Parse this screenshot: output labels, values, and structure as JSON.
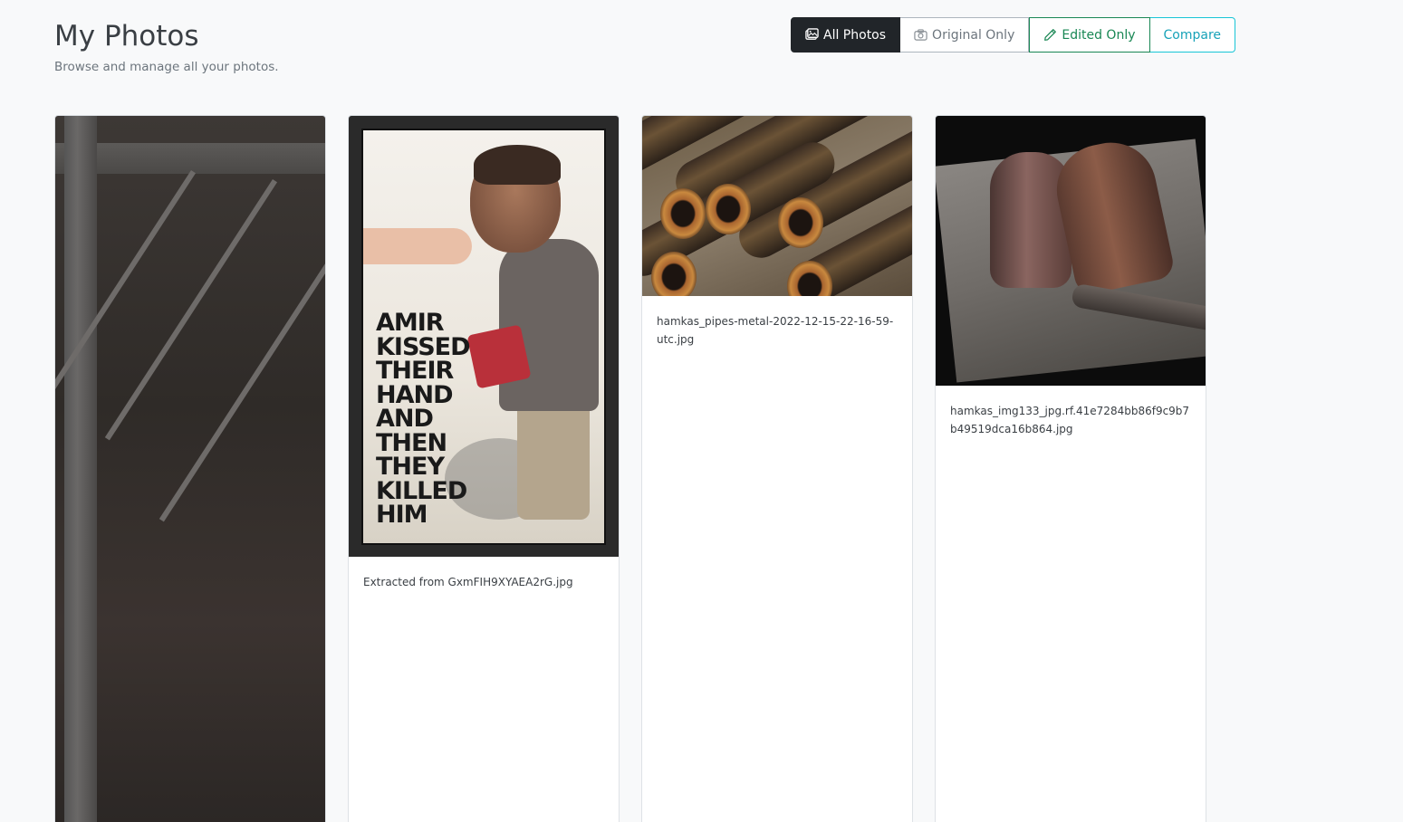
{
  "header": {
    "title": "My Photos",
    "subtitle": "Browse and manage all your photos."
  },
  "filters": {
    "all": {
      "label": "All Photos",
      "icon": "images-icon",
      "active": true
    },
    "original": {
      "label": "Original Only",
      "icon": "camera-icon"
    },
    "edited": {
      "label": "Edited Only",
      "icon": "pencil-icon"
    },
    "compare": {
      "label": "Compare"
    }
  },
  "photos": [
    {
      "caption": "",
      "alt": "metal fence close-up"
    },
    {
      "caption": "Extracted from GxmFIH9XYAEA2rG.jpg",
      "poster_text": [
        "AMIR",
        "KISSED",
        "THEIR",
        "HAND",
        "AND",
        "THEN",
        "THEY",
        "KILLED",
        "HIM"
      ]
    },
    {
      "caption": "hamkas_pipes-metal-2022-12-15-22-16-59-utc.jpg"
    },
    {
      "caption": "hamkas_img133_jpg.rf.41e7284bb86f9c9b7b49519dca16b864.jpg"
    }
  ],
  "colors": {
    "active_button": "#212529",
    "edited_accent": "#198754",
    "compare_accent": "#17a2b8"
  }
}
